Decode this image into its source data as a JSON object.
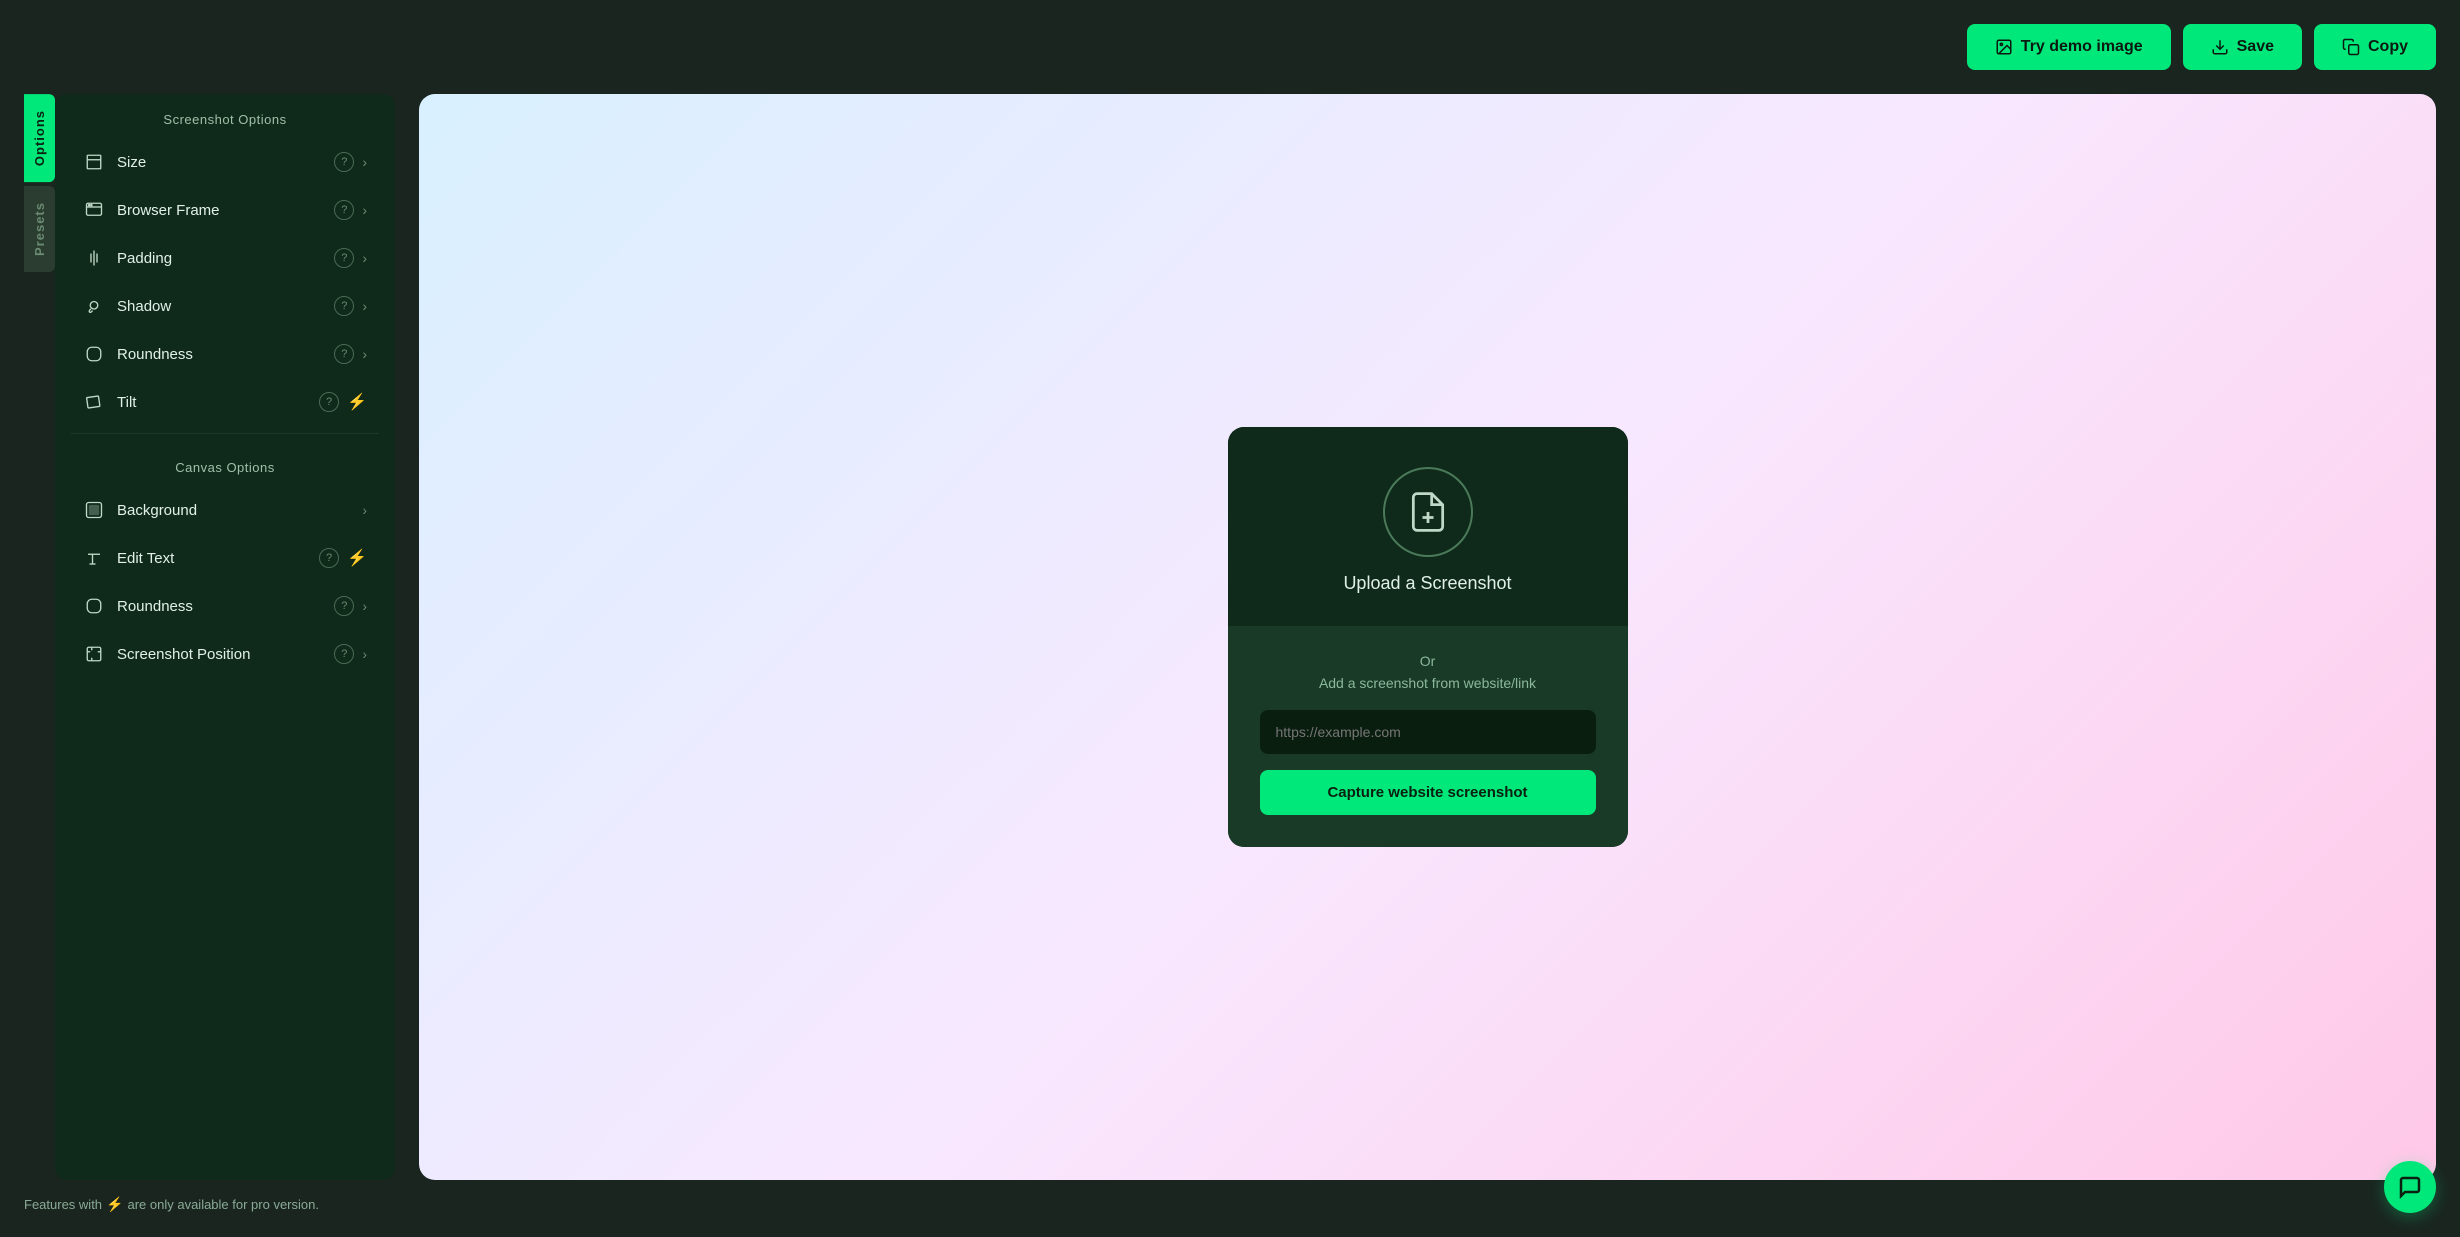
{
  "header": {
    "try_demo_label": "Try demo image",
    "save_label": "Save",
    "copy_label": "Copy"
  },
  "sidebar": {
    "tabs": [
      {
        "id": "options",
        "label": "Options",
        "active": true
      },
      {
        "id": "presets",
        "label": "Presets",
        "active": false
      }
    ],
    "section_screenshot": "Screenshot Options",
    "section_canvas": "Canvas Options",
    "items": [
      {
        "id": "size",
        "label": "Size",
        "icon": "size-icon",
        "has_help": true,
        "has_chevron": true,
        "has_lightning": false
      },
      {
        "id": "browser-frame",
        "label": "Browser Frame",
        "icon": "browser-icon",
        "has_help": true,
        "has_chevron": true,
        "has_lightning": false
      },
      {
        "id": "padding",
        "label": "Padding",
        "icon": "padding-icon",
        "has_help": true,
        "has_chevron": true,
        "has_lightning": false
      },
      {
        "id": "shadow",
        "label": "Shadow",
        "icon": "shadow-icon",
        "has_help": true,
        "has_chevron": true,
        "has_lightning": false
      },
      {
        "id": "roundness-screenshot",
        "label": "Roundness",
        "icon": "roundness-icon",
        "has_help": true,
        "has_chevron": true,
        "has_lightning": false
      },
      {
        "id": "tilt",
        "label": "Tilt",
        "icon": "tilt-icon",
        "has_help": true,
        "has_chevron": false,
        "has_lightning": true
      }
    ],
    "canvas_items": [
      {
        "id": "background",
        "label": "Background",
        "icon": "background-icon",
        "has_help": false,
        "has_chevron": true,
        "has_lightning": false
      },
      {
        "id": "edit-text",
        "label": "Edit Text",
        "icon": "text-icon",
        "has_help": true,
        "has_chevron": false,
        "has_lightning": true
      },
      {
        "id": "roundness-canvas",
        "label": "Roundness",
        "icon": "roundness2-icon",
        "has_help": true,
        "has_chevron": true,
        "has_lightning": false
      },
      {
        "id": "screenshot-position",
        "label": "Screenshot Position",
        "icon": "position-icon",
        "has_help": true,
        "has_chevron": true,
        "has_lightning": false
      }
    ]
  },
  "upload_card": {
    "upload_label": "Upload a Screenshot",
    "or_text": "Or",
    "add_text": "Add a screenshot from website/link",
    "url_placeholder": "https://example.com",
    "capture_button_label": "Capture website screenshot"
  },
  "footer": {
    "note_prefix": "Features with",
    "note_suffix": "are only available for pro version."
  },
  "colors": {
    "accent": "#00e87a",
    "bg_dark": "#1a2520",
    "panel_bg": "#0f2a1a",
    "lightning": "#f5c518"
  }
}
